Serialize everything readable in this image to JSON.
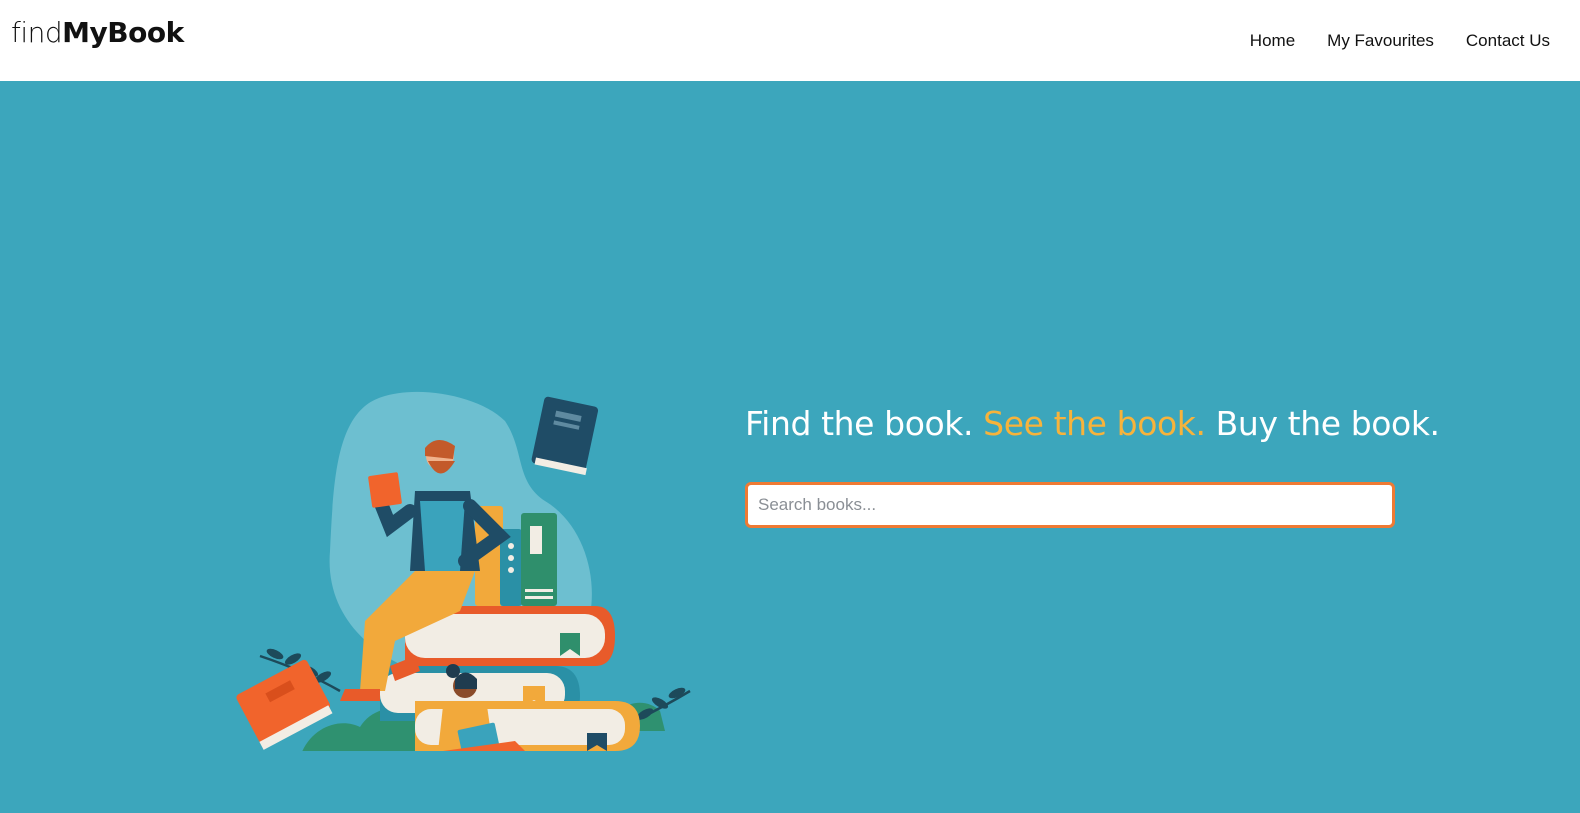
{
  "brand": {
    "prefix": "find",
    "name": "MyBook"
  },
  "nav": {
    "items": [
      {
        "label": "Home"
      },
      {
        "label": "My Favourites"
      },
      {
        "label": "Contact Us"
      }
    ]
  },
  "hero": {
    "headline_part1": "Find the book. ",
    "headline_part2": "See the book.",
    "headline_part3": " Buy the book.",
    "search_placeholder": "Search books...",
    "illustration": "reading-people-books-illustration"
  },
  "colors": {
    "hero_bg": "#3ca6bc",
    "accent": "#f7b33b",
    "search_border": "#ef7a33",
    "navbar_bg": "#ffffff"
  }
}
